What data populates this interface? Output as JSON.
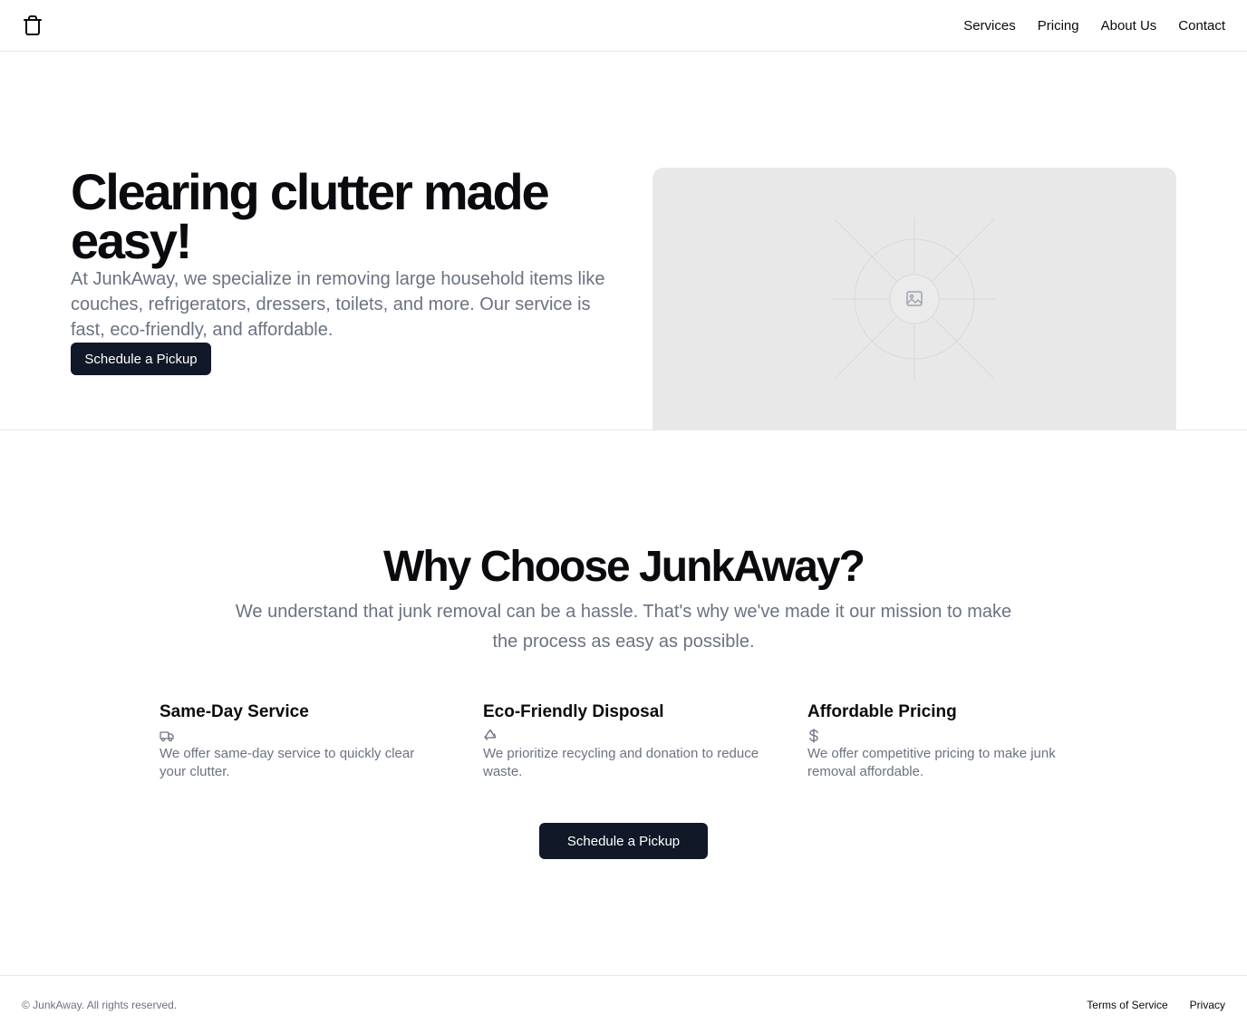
{
  "header": {
    "logo_icon": "trash-can-icon",
    "nav": [
      {
        "label": "Services"
      },
      {
        "label": "Pricing"
      },
      {
        "label": "About Us"
      },
      {
        "label": "Contact"
      }
    ]
  },
  "hero": {
    "title": "Clearing clutter made easy!",
    "description": "At JunkAway, we specialize in removing large household items like couches, refrigerators, dressers, toilets, and more. Our service is fast, eco-friendly, and affordable.",
    "cta_label": "Schedule a Pickup",
    "image_icon": "image-placeholder-icon"
  },
  "features": {
    "title": "Why Choose JunkAway?",
    "subtitle": "We understand that junk removal can be a hassle. That's why we've made it our mission to make the process as easy as possible.",
    "items": [
      {
        "title": "Same-Day Service",
        "icon": "truck-icon",
        "text": "We offer same-day service to quickly clear your clutter."
      },
      {
        "title": "Eco-Friendly Disposal",
        "icon": "recycle-icon",
        "text": "We prioritize recycling and donation to reduce waste."
      },
      {
        "title": "Affordable Pricing",
        "icon": "dollar-sign-icon",
        "text": "We offer competitive pricing to make junk removal affordable."
      }
    ],
    "cta_label": "Schedule a Pickup"
  },
  "footer": {
    "copyright": "© JunkAway. All rights reserved.",
    "links": [
      {
        "label": "Terms of Service"
      },
      {
        "label": "Privacy"
      }
    ]
  },
  "colors": {
    "primary_button": "#111827",
    "muted_text": "#6b7280",
    "border": "#e5e7eb",
    "placeholder_bg": "#e8e8e8"
  }
}
